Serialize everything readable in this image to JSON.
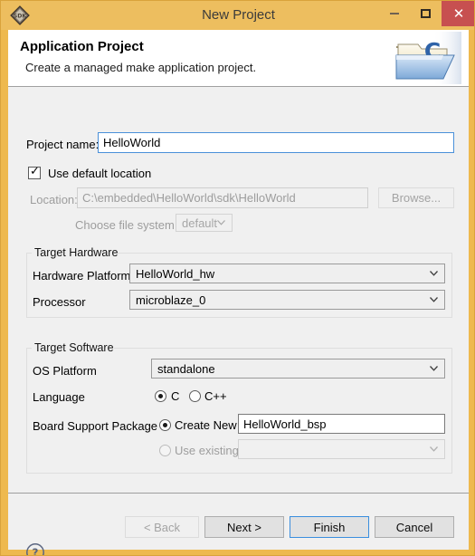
{
  "window": {
    "title": "New Project",
    "app_icon": "sdk-diamond-icon",
    "controls": {
      "minimize": "minimize-icon",
      "maximize": "maximize-icon",
      "close": "close-icon"
    },
    "colors": {
      "title_bar": "#edbe5f",
      "frame": "#eeb94e",
      "close_button": "#c75050",
      "body": "#f0f0f0",
      "focus_blue": "#4a90d9"
    }
  },
  "header": {
    "title": "Application Project",
    "subtitle": "Create a managed make application project.",
    "icon": "c-folder-icon"
  },
  "form": {
    "project_name": {
      "label": "Project name:",
      "value": "HelloWorld",
      "placeholder": ""
    },
    "use_default_location": {
      "label": "Use default location",
      "checked": true
    },
    "location": {
      "label": "Location:",
      "value": "C:\\embedded\\HelloWorld\\sdk\\HelloWorld",
      "enabled": false
    },
    "browse_button": {
      "label": "Browse...",
      "enabled": false
    },
    "file_system": {
      "label": "Choose file system:",
      "value": "default",
      "enabled": false
    }
  },
  "target_hardware": {
    "title": "Target Hardware",
    "hardware_platform": {
      "label": "Hardware Platform",
      "value": "HelloWorld_hw"
    },
    "processor": {
      "label": "Processor",
      "value": "microblaze_0"
    }
  },
  "target_software": {
    "title": "Target Software",
    "os_platform": {
      "label": "OS Platform",
      "value": "standalone"
    },
    "language": {
      "label": "Language",
      "options": [
        {
          "label": "C",
          "selected": true
        },
        {
          "label": "C++",
          "selected": false
        }
      ]
    },
    "board_support_package": {
      "label": "Board Support Package",
      "create_new": {
        "label": "Create New",
        "selected": true,
        "value": "HelloWorld_bsp"
      },
      "use_existing": {
        "label": "Use existing",
        "selected": false,
        "value": "",
        "enabled": false
      }
    }
  },
  "footer": {
    "help_icon": "help-question-icon",
    "buttons": [
      {
        "label": "< Back",
        "enabled": false,
        "focused": false
      },
      {
        "label": "Next >",
        "enabled": true,
        "focused": false
      },
      {
        "label": "Finish",
        "enabled": true,
        "focused": true
      },
      {
        "label": "Cancel",
        "enabled": true,
        "focused": false
      }
    ]
  }
}
